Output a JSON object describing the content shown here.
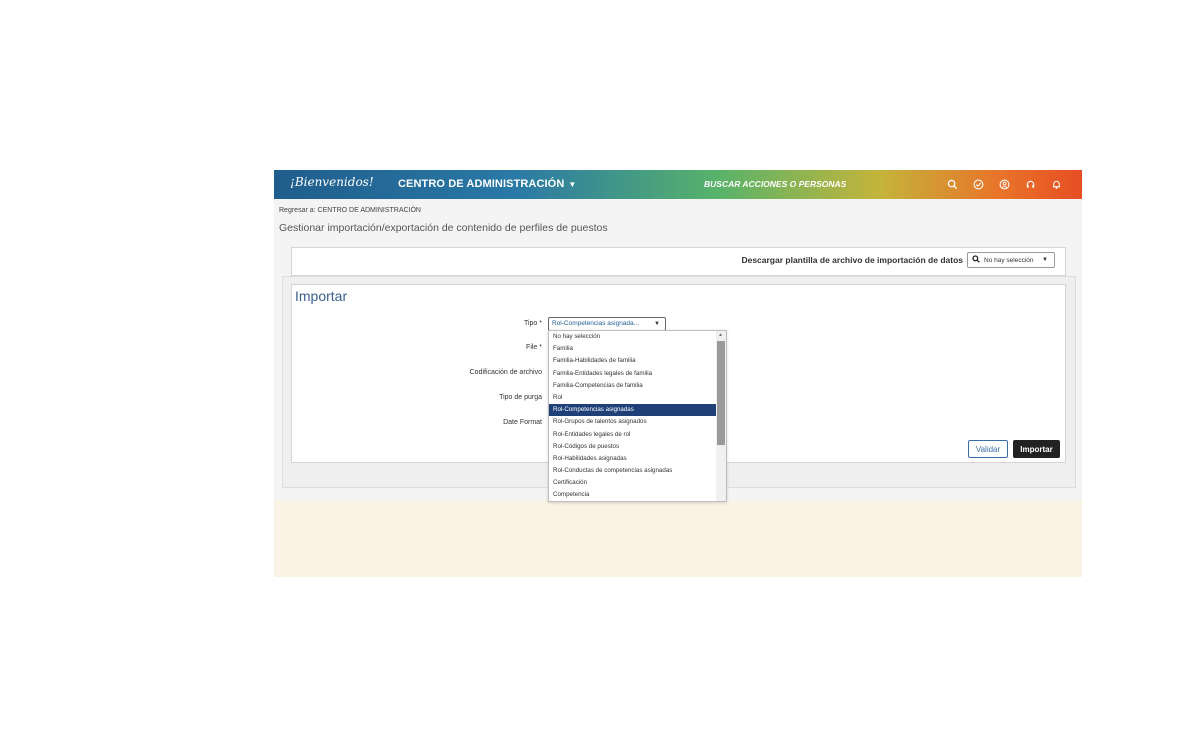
{
  "header": {
    "logo": "¡Bienvenidos!",
    "center_menu": "CENTRO DE ADMINISTRACIÓN",
    "search_link": "BUSCAR ACCIONES O PERSONAS",
    "icons": [
      "search-icon",
      "check-circle-icon",
      "help-person-icon",
      "headset-icon",
      "bell-icon"
    ]
  },
  "breadcrumb": {
    "prefix": "Regresar a: ",
    "link": "CENTRO DE ADMINISTRACIÓN"
  },
  "page_title": "Gestionar importación/exportación de contenido de perfiles de puestos",
  "download": {
    "label": "Descargar plantilla de archivo de importación de datos",
    "select_value": "No hay selección"
  },
  "import": {
    "title": "Importar",
    "fields": {
      "tipo": "Tipo *",
      "file": "File *",
      "codificacion": "Codificación de archivo",
      "purga": "Tipo de purga",
      "date_format": "Date Format"
    },
    "tipo_value": "Rol-Competencias asignada...",
    "validar": "Validar",
    "importar": "Importar"
  },
  "dropdown": {
    "options": [
      "No hay selección",
      "Familia",
      "Familia-Habilidades de familia",
      "Familia-Entidades legales de familia",
      "Familia-Competencias de familia",
      "Rol",
      "Rol-Competencias asignadas",
      "Rol-Grupos de talentos asignados",
      "Rol-Entidades legales de rol",
      "Rol-Códigos de puestos",
      "Rol-Habilidades asignadas",
      "Rol-Conductas de competencias asignadas",
      "Certificación",
      "Competencia"
    ],
    "selected": "Rol-Competencias asignadas"
  }
}
